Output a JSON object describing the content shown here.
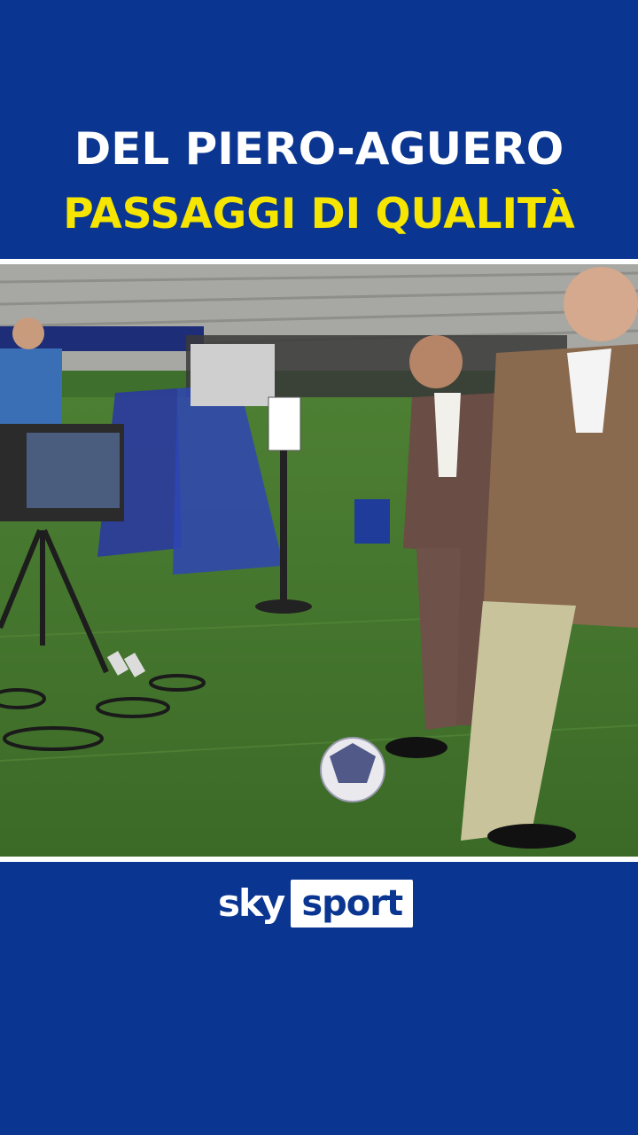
{
  "headline": {
    "line1": "DEL PIERO-AGUERO",
    "line2": "PASSAGGI DI QUALITÀ"
  },
  "brand": {
    "sky": "sky",
    "sport": "sport"
  },
  "colors": {
    "background": "#0a3590",
    "line1": "#ffffff",
    "line2": "#f6e500",
    "logo_sky": "#ffffff",
    "logo_sport": "#0a3590",
    "pitch": "#3f6f2c"
  },
  "icons": [
    "sky-sport-logo",
    "soccer-ball"
  ]
}
